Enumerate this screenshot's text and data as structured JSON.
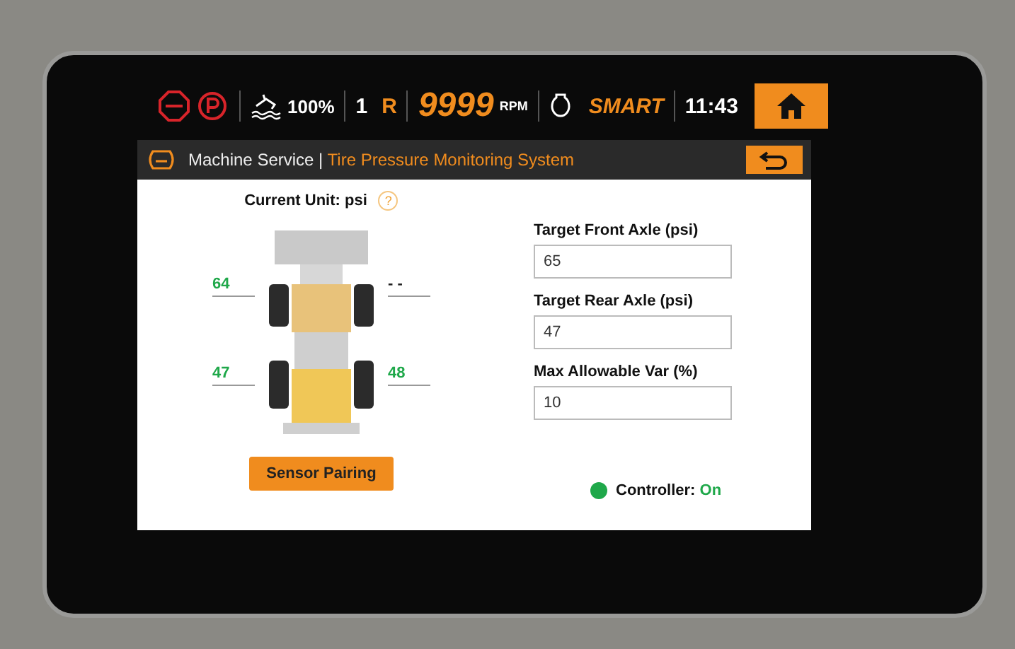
{
  "status_bar": {
    "fuel": "100%",
    "gear": "1",
    "direction": "R",
    "rpm_value": "9999",
    "rpm_unit": "RPM",
    "mode": "SMART",
    "time": "11:43"
  },
  "header": {
    "section": "Machine Service",
    "separator": "|",
    "page": "Tire Pressure Monitoring System"
  },
  "unit": {
    "label": "Current Unit: psi",
    "help": "?"
  },
  "tires": [
    {
      "reading": "64",
      "color": "#1fa84a"
    },
    {
      "reading": "- -",
      "color": "#222222"
    },
    {
      "reading": "47",
      "color": "#1fa84a"
    },
    {
      "reading": "48",
      "color": "#1fa84a"
    }
  ],
  "sensor_button": "Sensor Pairing",
  "fields": [
    {
      "label": "Target Front Axle (psi)",
      "value": "65"
    },
    {
      "label": "Target Rear Axle (psi)",
      "value": "47"
    },
    {
      "label": "Max Allowable Var (%)",
      "value": "10"
    }
  ],
  "controller": {
    "label": "Controller:",
    "status": "On",
    "on": true
  }
}
